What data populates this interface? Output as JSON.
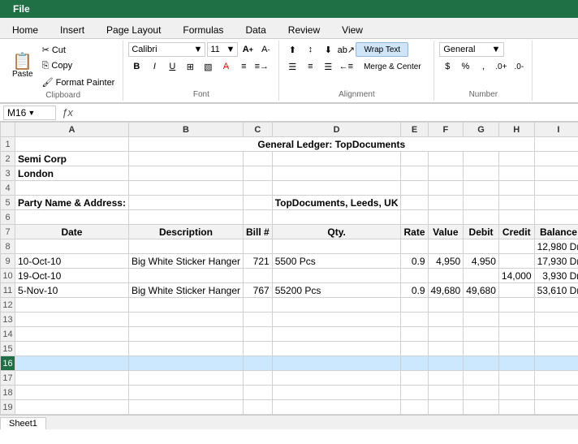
{
  "titlebar": {
    "label": "File"
  },
  "tabs": [
    {
      "label": "File",
      "active": true
    },
    {
      "label": "Home"
    },
    {
      "label": "Insert"
    },
    {
      "label": "Page Layout"
    },
    {
      "label": "Formulas"
    },
    {
      "label": "Data"
    },
    {
      "label": "Review"
    },
    {
      "label": "View"
    }
  ],
  "ribbon": {
    "clipboard_label": "Clipboard",
    "font_label": "Font",
    "alignment_label": "Alignment",
    "number_label": "Number",
    "paste_label": "Paste",
    "font_name": "Calibri",
    "font_size": "11",
    "wrap_text": "Wrap Text",
    "merge_center": "Merge & Center",
    "general": "General",
    "format_buttons": [
      "B",
      "I",
      "U"
    ],
    "align_buttons_row1": [
      "≡",
      "≡",
      "≡",
      "ab→",
      "←a"
    ],
    "align_buttons_row2": [
      "←",
      "≡",
      "→",
      "↕",
      "↕"
    ],
    "number_buttons": [
      "$",
      "%",
      ",",
      ".0+",
      ".0-"
    ]
  },
  "formula_bar": {
    "cell_ref": "M16",
    "fx": "ƒx",
    "value": ""
  },
  "spreadsheet": {
    "col_headers": [
      "",
      "A",
      "B",
      "C",
      "D",
      "E",
      "F",
      "G",
      "H",
      "I"
    ],
    "rows": [
      {
        "row": 1,
        "cells": [
          "",
          "",
          "",
          "",
          "",
          "",
          "",
          "",
          "",
          ""
        ]
      },
      {
        "row": 2,
        "cells": [
          "",
          "Semi Corp",
          "",
          "",
          "",
          "",
          "",
          "",
          "",
          ""
        ]
      },
      {
        "row": 3,
        "cells": [
          "",
          "London",
          "",
          "",
          "",
          "",
          "",
          "",
          "",
          ""
        ]
      },
      {
        "row": 4,
        "cells": [
          "",
          "",
          "",
          "",
          "",
          "",
          "",
          "",
          "",
          ""
        ]
      },
      {
        "row": 5,
        "cells": [
          "",
          "Party Name & Address:",
          "",
          "",
          "TopDocuments, Leeds, UK",
          "",
          "",
          "",
          "",
          ""
        ]
      },
      {
        "row": 6,
        "cells": [
          "",
          "",
          "",
          "",
          "",
          "",
          "",
          "",
          "",
          ""
        ]
      },
      {
        "row": 7,
        "cells": [
          "",
          "Date",
          "Description",
          "Bill #",
          "Qty.",
          "Rate",
          "Value",
          "Debit",
          "Credit",
          "Balance"
        ]
      },
      {
        "row": 8,
        "cells": [
          "",
          "",
          "",
          "",
          "",
          "",
          "",
          "",
          "",
          "12,980 Dr"
        ]
      },
      {
        "row": 9,
        "cells": [
          "",
          "10-Oct-10",
          "Big White Sticker Hanger",
          "721",
          "5500 Pcs",
          "0.9",
          "4,950",
          "4,950",
          "",
          "17,930 Dr"
        ]
      },
      {
        "row": 10,
        "cells": [
          "",
          "19-Oct-10",
          "",
          "",
          "",
          "",
          "",
          "",
          "14,000",
          "3,930 Dr"
        ]
      },
      {
        "row": 11,
        "cells": [
          "",
          "5-Nov-10",
          "Big White Sticker Hanger",
          "767",
          "55200 Pcs",
          "0.9",
          "49,680",
          "49,680",
          "",
          "53,610 Dr"
        ]
      },
      {
        "row": 12,
        "cells": [
          "",
          "",
          "",
          "",
          "",
          "",
          "",
          "",
          "",
          ""
        ]
      },
      {
        "row": 13,
        "cells": [
          "",
          "",
          "",
          "",
          "",
          "",
          "",
          "",
          "",
          ""
        ]
      },
      {
        "row": 14,
        "cells": [
          "",
          "",
          "",
          "",
          "",
          "",
          "",
          "",
          "",
          ""
        ]
      },
      {
        "row": 15,
        "cells": [
          "",
          "",
          "",
          "",
          "",
          "",
          "",
          "",
          "",
          ""
        ]
      },
      {
        "row": 16,
        "cells": [
          "",
          "",
          "",
          "",
          "",
          "",
          "",
          "",
          "",
          ""
        ]
      },
      {
        "row": 17,
        "cells": [
          "",
          "",
          "",
          "",
          "",
          "",
          "",
          "",
          "",
          ""
        ]
      },
      {
        "row": 18,
        "cells": [
          "",
          "",
          "",
          "",
          "",
          "",
          "",
          "",
          "",
          ""
        ]
      },
      {
        "row": 19,
        "cells": [
          "",
          "",
          "",
          "",
          "",
          "",
          "",
          "",
          "",
          ""
        ]
      }
    ],
    "title_row": 1,
    "title_text": "General Ledger: TopDocuments",
    "title_col_span": 7,
    "active_row": 16,
    "active_col": "M"
  },
  "sheet_tab": "Sheet1"
}
